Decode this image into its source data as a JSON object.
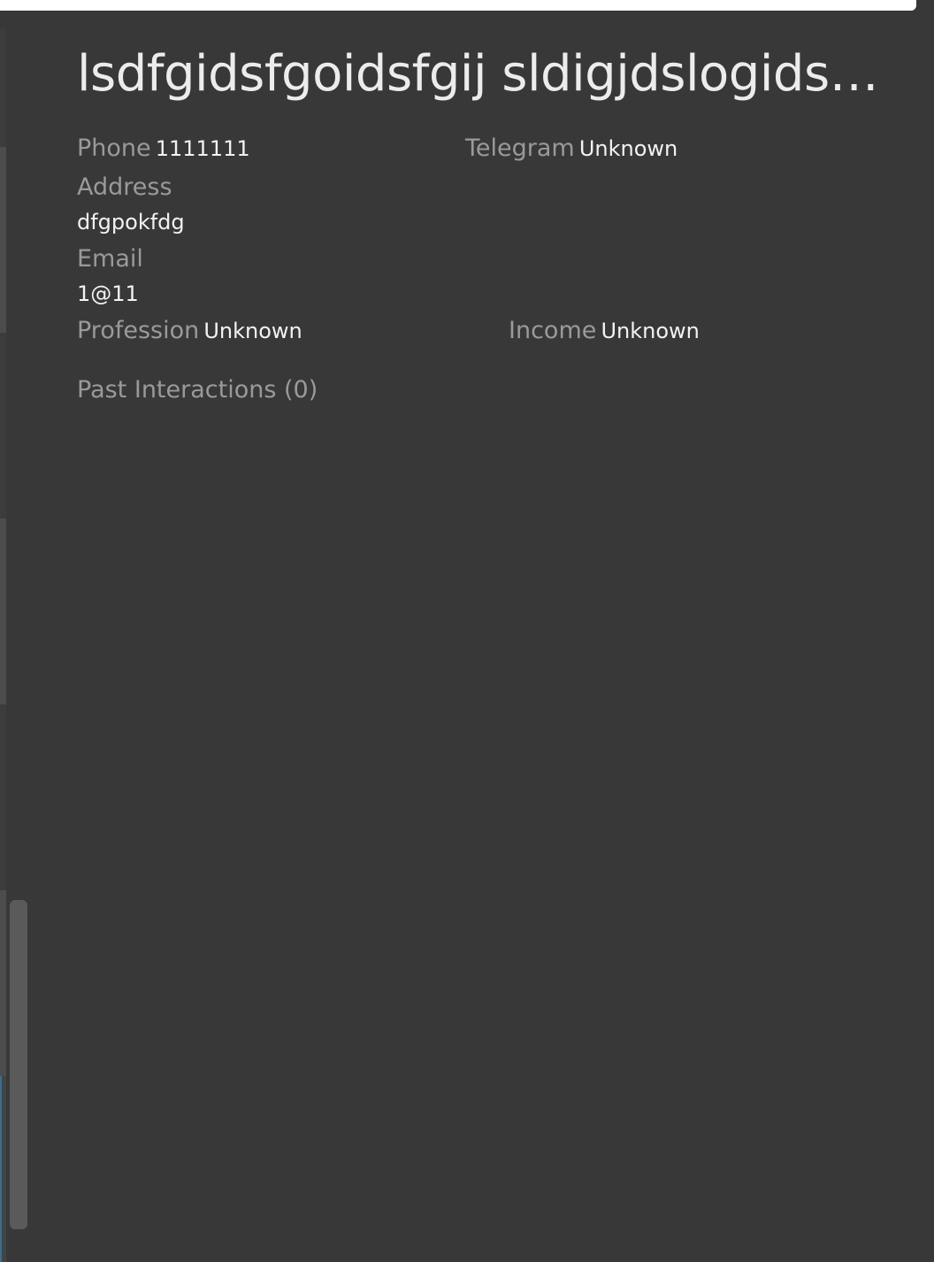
{
  "contact": {
    "name": "lsdfgidsfgoidsfgij sldigjdslogidslfgjsdflgkjsdfg",
    "phone_label": "Phone",
    "phone_value": "1111111",
    "telegram_label": "Telegram",
    "telegram_value": "Unknown",
    "address_label": "Address",
    "address_value": "dfgpokfdg",
    "email_label": "Email",
    "email_value": "1@11",
    "profession_label": "Profession",
    "profession_value": "Unknown",
    "income_label": "Income",
    "income_value": "Unknown",
    "past_interactions_label": "Past Interactions (0)"
  },
  "colors": {
    "background": "#383838",
    "label": "#9a9a9a",
    "value": "#f2f2f2",
    "title": "#ececec"
  }
}
